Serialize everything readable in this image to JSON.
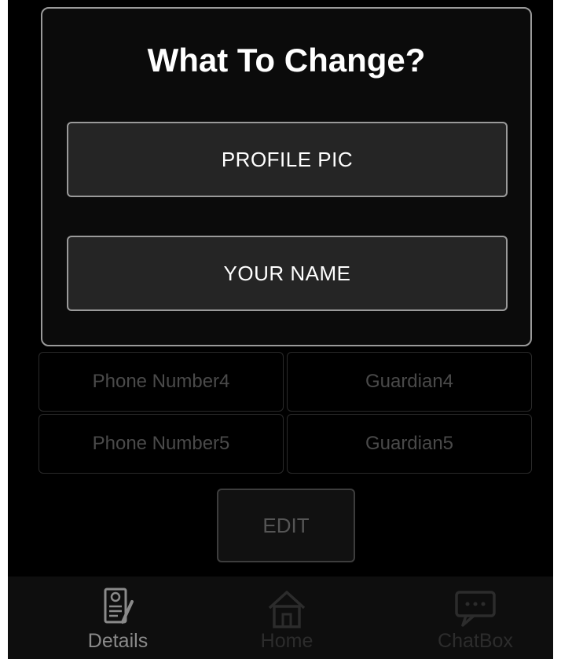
{
  "background_list": {
    "rows": [
      {
        "left": "Phone Number4",
        "right": "Guardian4"
      },
      {
        "left": "Phone Number5",
        "right": "Guardian5"
      }
    ],
    "edit_label": "EDIT"
  },
  "dialog": {
    "title": "What To Change?",
    "options": [
      {
        "label": "PROFILE PIC"
      },
      {
        "label": "YOUR NAME"
      }
    ]
  },
  "bottom_nav": {
    "items": [
      {
        "label": "Details",
        "icon": "details-icon",
        "active": true
      },
      {
        "label": "Home",
        "icon": "home-icon",
        "active": false
      },
      {
        "label": "ChatBox",
        "icon": "chat-icon",
        "active": false
      }
    ]
  },
  "colors": {
    "background": "#000000",
    "dialog_border": "#9a9a9a",
    "option_fill": "#252525",
    "text_primary": "#ffffff"
  }
}
